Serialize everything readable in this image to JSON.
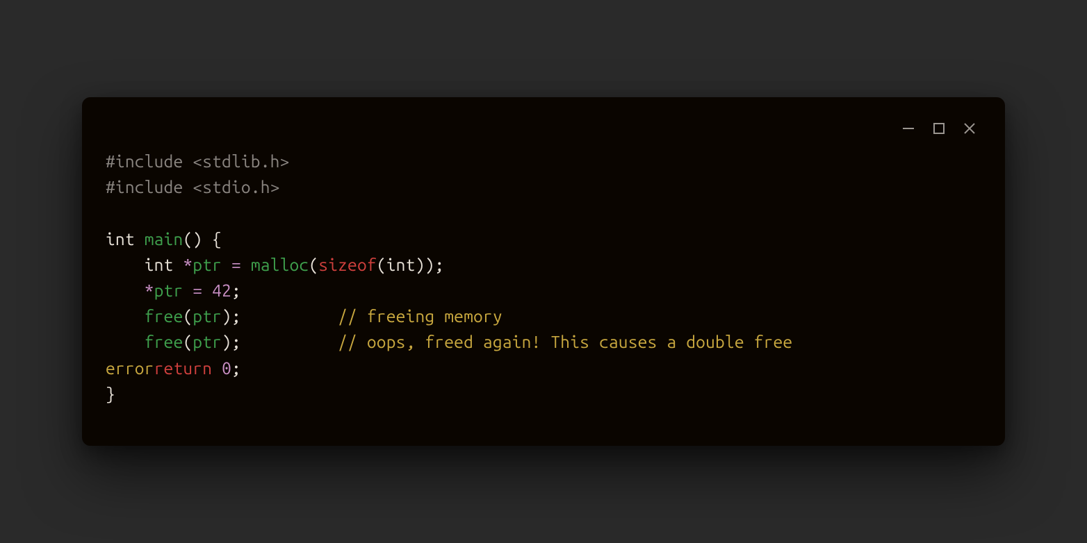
{
  "code": {
    "l1_include1": "#include <stdlib.h>",
    "l2_include2": "#include <stdio.h>",
    "l3_blank": "",
    "l4": {
      "int": "int",
      "main": "main",
      "rest": "() {"
    },
    "l5": {
      "indent": "    ",
      "int": "int",
      "star": "*",
      "ptr": "ptr",
      "eq": " = ",
      "malloc": "malloc",
      "open": "(",
      "sizeof": "sizeof",
      "open2": "(",
      "int2": "int",
      "close": "));"
    },
    "l6": {
      "indent": "    ",
      "star": "*",
      "ptr": "ptr",
      "eq": " = ",
      "num": "42",
      "semi": ";"
    },
    "l7": {
      "indent": "    ",
      "free": "free",
      "open": "(",
      "ptr": "ptr",
      "close": ");",
      "pad": "          ",
      "comment": "// freeing memory"
    },
    "l8": {
      "indent": "    ",
      "free": "free",
      "open": "(",
      "ptr": "ptr",
      "close": ");",
      "pad": "          ",
      "comment": "// oops, freed again! This causes a double free "
    },
    "l9": {
      "error": "error",
      "return": "return",
      "sp": " ",
      "zero": "0",
      "semi": ";"
    },
    "l10_brace": "}"
  },
  "icons": {
    "minimize": "minimize-icon",
    "maximize": "maximize-icon",
    "close": "close-icon"
  }
}
